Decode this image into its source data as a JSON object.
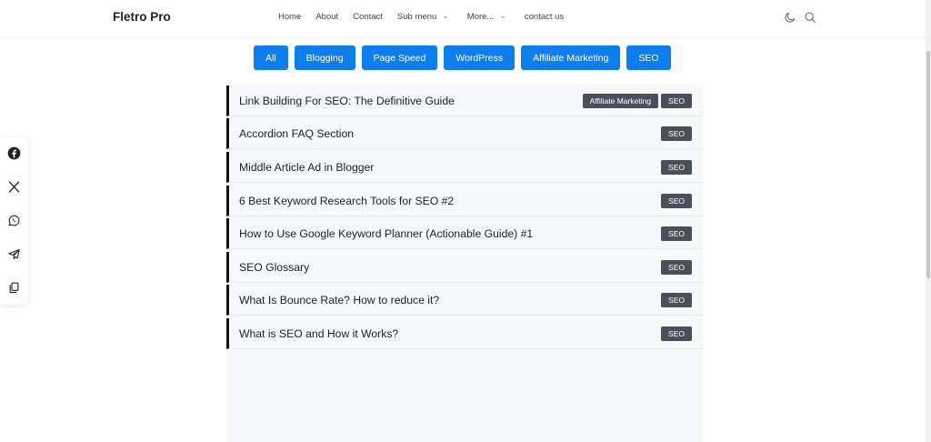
{
  "header": {
    "brand": "Fletro Pro",
    "nav": [
      {
        "label": "Home"
      },
      {
        "label": "About"
      },
      {
        "label": "Contact"
      },
      {
        "label": "Sub menu",
        "dropdown": true
      },
      {
        "label": "More...",
        "dropdown": true
      },
      {
        "label": "contact us"
      }
    ],
    "icons": [
      "dark-mode-moon-icon",
      "search-icon"
    ]
  },
  "filters": [
    "All",
    "Blogging",
    "Page Speed",
    "WordPress",
    "Affiliate Marketing",
    "SEO"
  ],
  "posts": [
    {
      "title": "Link Building For SEO: The Definitive Guide",
      "tags": [
        "Affiliate Marketing",
        "SEO"
      ]
    },
    {
      "title": "Accordion FAQ Section",
      "tags": [
        "SEO"
      ]
    },
    {
      "title": "Middle Article Ad in Blogger",
      "tags": [
        "SEO"
      ]
    },
    {
      "title": "6 Best Keyword Research Tools for SEO #2",
      "tags": [
        "SEO"
      ]
    },
    {
      "title": "How to Use Google Keyword Planner (Actionable Guide) #1",
      "tags": [
        "SEO"
      ]
    },
    {
      "title": "SEO Glossary",
      "tags": [
        "SEO"
      ]
    },
    {
      "title": "What Is Bounce Rate? How to reduce it?",
      "tags": [
        "SEO"
      ]
    },
    {
      "title": "What is SEO and How it Works?",
      "tags": [
        "SEO"
      ]
    }
  ],
  "share": [
    "facebook-icon",
    "x-twitter-icon",
    "whatsapp-icon",
    "telegram-icon",
    "copy-link-icon"
  ],
  "colors": {
    "accent": "#0d7ef0",
    "tag_bg": "#4b5058",
    "row_border": "#111111",
    "panel_bg": "#f7f8f9"
  }
}
